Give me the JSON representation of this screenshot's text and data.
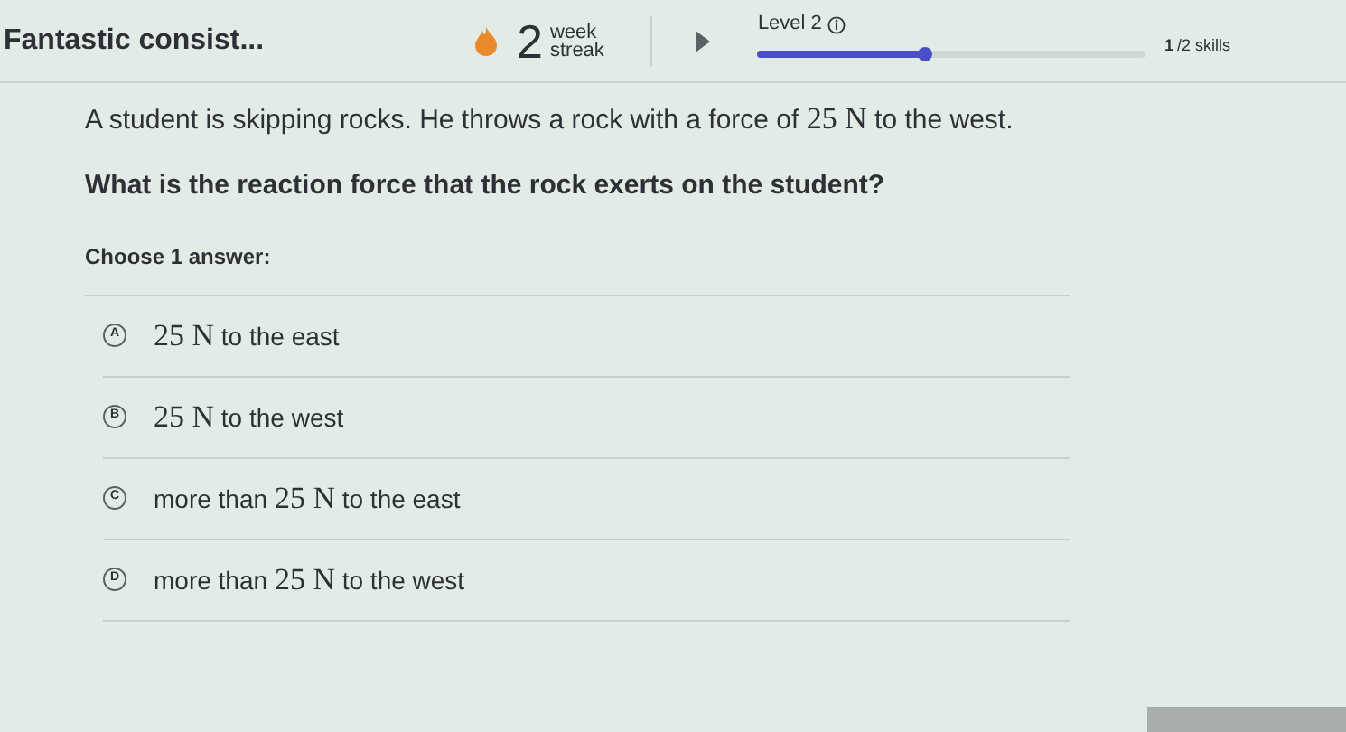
{
  "header": {
    "title": "Fantastic consist...",
    "streak_count": "2",
    "streak_label_top": "week",
    "streak_label_bottom": "streak",
    "level_label": "Level 2",
    "level": 0.43,
    "skills_done": "1",
    "skills_total": "/2 skills"
  },
  "question": {
    "prompt": [
      {
        "kind": "text",
        "text": "A student is skipping rocks. He throws a rock with a force of "
      },
      {
        "kind": "math",
        "text": "25 N"
      },
      {
        "kind": "text",
        "text": " to the west."
      }
    ],
    "ask": "What is the reaction force that the rock exerts on the student?",
    "choose_label": "Choose 1 answer:",
    "answers": [
      {
        "letter": "A",
        "selected": false,
        "parts": [
          {
            "kind": "math",
            "text": "25 N"
          },
          {
            "kind": "text",
            "text": " to the east"
          }
        ]
      },
      {
        "letter": "B",
        "selected": false,
        "parts": [
          {
            "kind": "math",
            "text": "25 N"
          },
          {
            "kind": "text",
            "text": " to the west"
          }
        ]
      },
      {
        "letter": "C",
        "selected": false,
        "parts": [
          {
            "kind": "text",
            "text": "more than "
          },
          {
            "kind": "math",
            "text": "25 N"
          },
          {
            "kind": "text",
            "text": " to the east"
          }
        ]
      },
      {
        "letter": "D",
        "selected": false,
        "parts": [
          {
            "kind": "text",
            "text": "more than "
          },
          {
            "kind": "math",
            "text": "25 N"
          },
          {
            "kind": "text",
            "text": " to the west"
          }
        ]
      }
    ]
  }
}
